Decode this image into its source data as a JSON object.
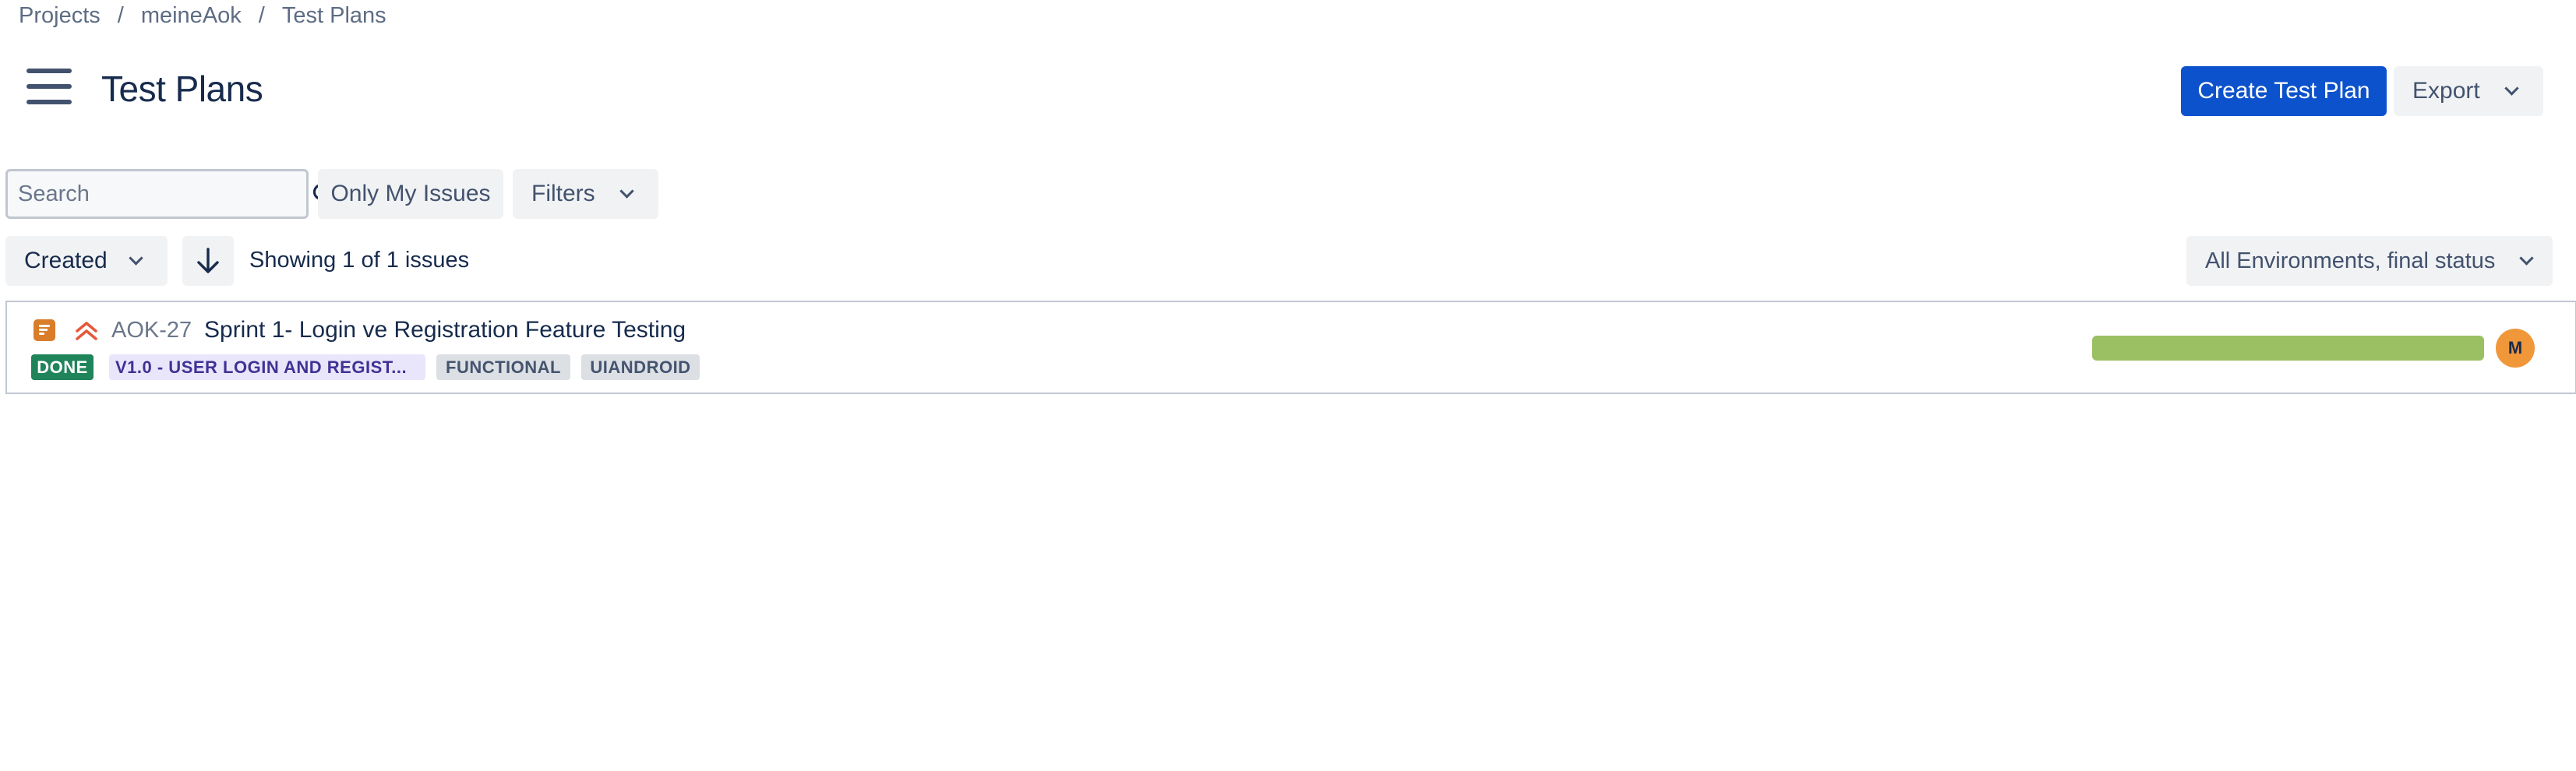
{
  "breadcrumb": {
    "items": [
      "Projects",
      "meineAok",
      "Test Plans"
    ],
    "separator": "/"
  },
  "header": {
    "title": "Test Plans",
    "create_button": "Create Test Plan",
    "export_button": "Export"
  },
  "toolbar": {
    "search_placeholder": "Search",
    "search_value": "",
    "only_my_issues": "Only My Issues",
    "filters": "Filters",
    "sort_field": "Created",
    "showing_text": "Showing 1 of 1 issues",
    "environment_select": "All Environments, final status"
  },
  "issues": [
    {
      "key": "AOK-27",
      "summary": "Sprint 1- Login ve Registration Feature Testing",
      "status": "DONE",
      "labels": [
        "V1.0 - USER LOGIN AND REGIST...",
        "FUNCTIONAL",
        "UIANDROID"
      ],
      "type_icon": "test-plan-icon",
      "priority_icon": "priority-highest-icon",
      "progress": 1.0,
      "assignee_initial": "M"
    }
  ],
  "colors": {
    "primary": "#0c52cc",
    "done": "#1f845a",
    "version_lozenge_bg": "#e9e6fb",
    "version_lozenge_text": "#403294",
    "progress": "#9bbf63",
    "avatar": "#f0973a",
    "priority": "#e5593b"
  }
}
